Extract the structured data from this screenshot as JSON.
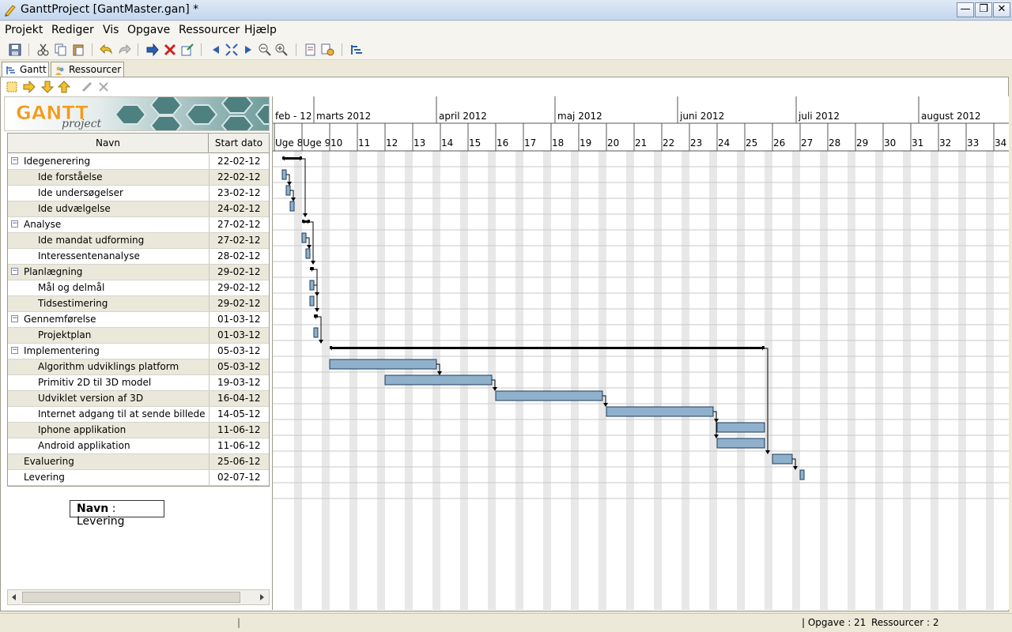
{
  "window": {
    "title": "GanttProject [GantMaster.gan] *",
    "min": "—",
    "max": "❐",
    "close": "✕"
  },
  "menu": [
    "Projekt",
    "Rediger",
    "Vis",
    "Opgave",
    "Ressourcer",
    "Hjælp"
  ],
  "tabs": [
    {
      "label": "Gantt"
    },
    {
      "label": "Ressourcer"
    }
  ],
  "logo": {
    "word": "GANTT",
    "sub": "project"
  },
  "table": {
    "headers": {
      "name": "Navn",
      "start": "Start dato"
    },
    "rows": [
      {
        "name": "Idegenerering",
        "start": "22-02-12",
        "level": 0,
        "group": true
      },
      {
        "name": "Ide forståelse",
        "start": "22-02-12",
        "level": 1,
        "group": false
      },
      {
        "name": "Ide undersøgelser",
        "start": "23-02-12",
        "level": 1,
        "group": false
      },
      {
        "name": "Ide udvælgelse",
        "start": "24-02-12",
        "level": 1,
        "group": false
      },
      {
        "name": "Analyse",
        "start": "27-02-12",
        "level": 0,
        "group": true
      },
      {
        "name": "Ide mandat udforming",
        "start": "27-02-12",
        "level": 1,
        "group": false
      },
      {
        "name": "Interessentenanalyse",
        "start": "28-02-12",
        "level": 1,
        "group": false
      },
      {
        "name": "Planlægning",
        "start": "29-02-12",
        "level": 0,
        "group": true
      },
      {
        "name": "Mål og delmål",
        "start": "29-02-12",
        "level": 1,
        "group": false
      },
      {
        "name": "Tidsestimering",
        "start": "29-02-12",
        "level": 1,
        "group": false
      },
      {
        "name": "Gennemførelse",
        "start": "01-03-12",
        "level": 0,
        "group": true
      },
      {
        "name": "Projektplan",
        "start": "01-03-12",
        "level": 1,
        "group": false
      },
      {
        "name": "Implementering",
        "start": "05-03-12",
        "level": 0,
        "group": true
      },
      {
        "name": "Algorithm udviklings platform",
        "start": "05-03-12",
        "level": 1,
        "group": false
      },
      {
        "name": "Primitiv 2D til 3D model",
        "start": "19-03-12",
        "level": 1,
        "group": false
      },
      {
        "name": "Udviklet version af 3D",
        "start": "16-04-12",
        "level": 1,
        "group": false
      },
      {
        "name": "Internet adgang til at sende billede",
        "start": "14-05-12",
        "level": 1,
        "group": false
      },
      {
        "name": "Iphone applikation",
        "start": "11-06-12",
        "level": 1,
        "group": false
      },
      {
        "name": "Android applikation",
        "start": "11-06-12",
        "level": 1,
        "group": false
      },
      {
        "name": "Evaluering",
        "start": "25-06-12",
        "level": 0,
        "group": false
      },
      {
        "name": "Levering",
        "start": "02-07-12",
        "level": 0,
        "group": false
      }
    ]
  },
  "tooltip": {
    "label": "Navn",
    "sep": " : ",
    "value": "Levering"
  },
  "timeline": {
    "months": [
      "feb - 12",
      "marts 2012",
      "april 2012",
      "maj 2012",
      "juni 2012",
      "juli 2012",
      "august 2012"
    ],
    "weeks": [
      "Uge 8",
      "Uge 9",
      "10",
      "11",
      "12",
      "13",
      "14",
      "15",
      "16",
      "17",
      "18",
      "19",
      "20",
      "21",
      "22",
      "23",
      "24",
      "25",
      "26",
      "27",
      "28",
      "29",
      "30",
      "31",
      "32",
      "33",
      "34"
    ]
  },
  "gantt": {
    "bars": [
      {
        "row": 0,
        "start": "2012-02-22",
        "end": "2012-02-27",
        "type": "summary"
      },
      {
        "row": 1,
        "start": "2012-02-22",
        "end": "2012-02-23",
        "type": "task"
      },
      {
        "row": 2,
        "start": "2012-02-23",
        "end": "2012-02-24",
        "type": "task"
      },
      {
        "row": 3,
        "start": "2012-02-24",
        "end": "2012-02-25",
        "type": "task"
      },
      {
        "row": 4,
        "start": "2012-02-27",
        "end": "2012-02-29",
        "type": "summary"
      },
      {
        "row": 5,
        "start": "2012-02-27",
        "end": "2012-02-28",
        "type": "task"
      },
      {
        "row": 6,
        "start": "2012-02-28",
        "end": "2012-02-29",
        "type": "task"
      },
      {
        "row": 7,
        "start": "2012-02-29",
        "end": "2012-03-01",
        "type": "summary"
      },
      {
        "row": 8,
        "start": "2012-02-29",
        "end": "2012-03-01",
        "type": "task"
      },
      {
        "row": 9,
        "start": "2012-02-29",
        "end": "2012-03-01",
        "type": "task"
      },
      {
        "row": 10,
        "start": "2012-03-01",
        "end": "2012-03-02",
        "type": "summary"
      },
      {
        "row": 11,
        "start": "2012-03-01",
        "end": "2012-03-02",
        "type": "task"
      },
      {
        "row": 12,
        "start": "2012-03-05",
        "end": "2012-06-23",
        "type": "summary"
      },
      {
        "row": 13,
        "start": "2012-03-05",
        "end": "2012-04-01",
        "type": "task"
      },
      {
        "row": 14,
        "start": "2012-03-19",
        "end": "2012-04-15",
        "type": "task"
      },
      {
        "row": 15,
        "start": "2012-04-16",
        "end": "2012-05-13",
        "type": "task"
      },
      {
        "row": 16,
        "start": "2012-05-14",
        "end": "2012-06-10",
        "type": "task"
      },
      {
        "row": 17,
        "start": "2012-06-11",
        "end": "2012-06-23",
        "type": "task"
      },
      {
        "row": 18,
        "start": "2012-06-11",
        "end": "2012-06-23",
        "type": "task"
      },
      {
        "row": 19,
        "start": "2012-06-25",
        "end": "2012-06-30",
        "type": "task"
      },
      {
        "row": 20,
        "start": "2012-07-02",
        "end": "2012-07-03",
        "type": "task"
      }
    ],
    "links": [
      [
        0,
        4
      ],
      [
        4,
        7
      ],
      [
        7,
        10
      ],
      [
        10,
        12
      ],
      [
        12,
        19
      ],
      [
        19,
        20
      ]
    ]
  },
  "status": {
    "tasks": "| Opgave : 21",
    "resources": "Ressourcer : 2"
  },
  "colors": {
    "bar": "#8fb1cb",
    "bar_border": "#1e3a5c",
    "weekend": "#e8e8e8",
    "row_alt": "#e9e8da"
  }
}
